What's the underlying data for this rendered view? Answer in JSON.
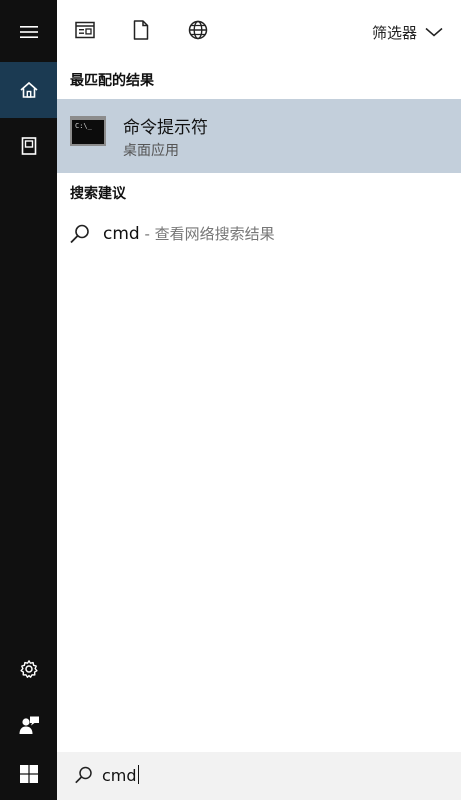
{
  "sidebar": {
    "items": [
      {
        "icon": "hamburger-menu-icon"
      },
      {
        "icon": "home-icon",
        "active": true
      },
      {
        "icon": "document-collection-icon"
      },
      {
        "icon": "settings-gear-icon"
      },
      {
        "icon": "user-feedback-icon"
      }
    ]
  },
  "topbar": {
    "icons": [
      "apps-window-icon",
      "document-icon",
      "web-globe-icon"
    ],
    "filter_label": "筛选器"
  },
  "best_match": {
    "section_title": "最匹配的结果",
    "app_name": "命令提示符",
    "app_type": "桌面应用",
    "icon_text": "C:\\_"
  },
  "suggestions": {
    "section_title": "搜索建议",
    "items": [
      {
        "query": "cmd",
        "hint": " - 查看网络搜索结果"
      }
    ]
  },
  "searchbox": {
    "value": "cmd"
  },
  "colors": {
    "sidebar_bg": "#101010",
    "active_item_bg": "#1b3a52",
    "selection_bg": "#c3cfdb",
    "searchbar_bg": "#f2f2f2"
  }
}
